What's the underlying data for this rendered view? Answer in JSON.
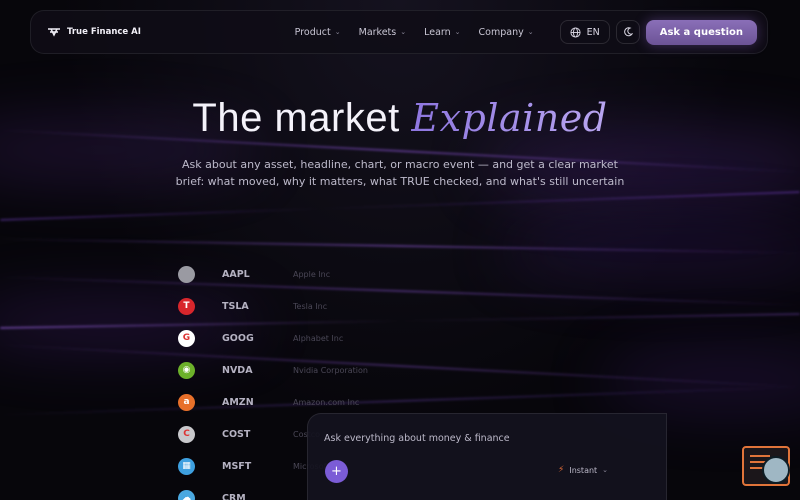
{
  "brand": {
    "name": "True Finance AI"
  },
  "nav": {
    "items": [
      {
        "label": "Product"
      },
      {
        "label": "Markets"
      },
      {
        "label": "Learn"
      },
      {
        "label": "Company"
      }
    ],
    "language": "EN",
    "cta_label": "Ask a question"
  },
  "hero": {
    "title_plain": "The market",
    "title_emphasis": "Explained",
    "subtitle_line1": "Ask about any asset, headline, chart, or macro event — and get a clear market",
    "subtitle_line2": "brief: what moved, why it matters, what TRUE checked, and what's still uncertain"
  },
  "tickers": [
    {
      "symbol": "AAPL",
      "name": "Apple Inc",
      "icon": "apple-icon",
      "color": "#9a9aa2"
    },
    {
      "symbol": "TSLA",
      "name": "Tesla Inc",
      "icon": "tesla-icon",
      "color": "#d8262c"
    },
    {
      "symbol": "GOOG",
      "name": "Alphabet Inc",
      "icon": "google-icon",
      "color": "#ffffff"
    },
    {
      "symbol": "NVDA",
      "name": "Nvidia Corporation",
      "icon": "nvidia-icon",
      "color": "#6cb12a"
    },
    {
      "symbol": "AMZN",
      "name": "Amazon.com Inc",
      "icon": "amazon-icon",
      "color": "#e8702a"
    },
    {
      "symbol": "COST",
      "name": "Costco",
      "icon": "costco-icon",
      "color": "#c8c8cc"
    },
    {
      "symbol": "MSFT",
      "name": "Microsoft",
      "icon": "microsoft-icon",
      "color": "#3ea0e0"
    },
    {
      "symbol": "CRM",
      "name": "",
      "icon": "salesforce-icon",
      "color": "#4aa8e0"
    }
  ],
  "chat": {
    "placeholder": "Ask everything about money & finance",
    "mode_label": "Instant"
  }
}
